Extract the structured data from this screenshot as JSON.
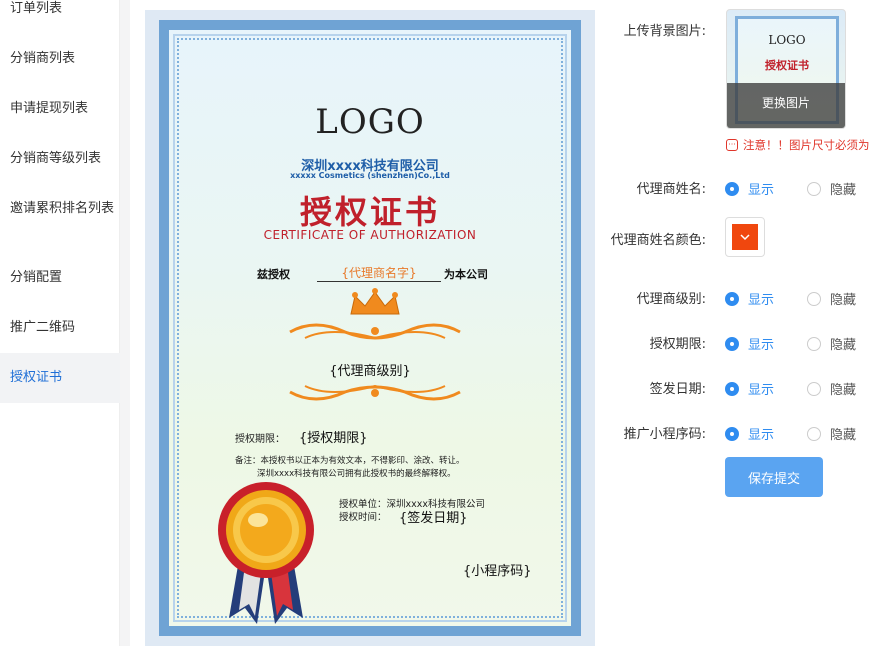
{
  "sidebar": {
    "items": [
      {
        "label": "订单列表"
      },
      {
        "label": "分销商列表"
      },
      {
        "label": "申请提现列表"
      },
      {
        "label": "分销商等级列表"
      },
      {
        "label": "邀请累积排名列表"
      },
      {
        "label": "分销配置"
      },
      {
        "label": "推广二维码"
      },
      {
        "label": "授权证书"
      }
    ],
    "active_index": 7
  },
  "certificate": {
    "logo": "LOGO",
    "company_cn": "深圳xxxx科技有限公司",
    "company_en": "xxxxx Cosmetics (shenzhen)Co.,Ltd",
    "title_cn": "授权证书",
    "title_en": "CERTIFICATE OF AUTHORIZATION",
    "grant_prefix": "兹授权",
    "agent_name_placeholder": "{代理商名字}",
    "grant_suffix": "为本公司",
    "agent_level_placeholder": "{代理商级别}",
    "period_label": "授权期限：",
    "period_placeholder": "{授权期限}",
    "note_line1": "备注：本授权书以正本为有效文本，不得影印、涂改、转让。",
    "note_line2": "深圳xxxx科技有限公司拥有此授权书的最终解释权。",
    "unit_line": "授权单位：深圳xxxx科技有限公司",
    "time_label": "授权时间：",
    "date_placeholder": "{签发日期}",
    "qrcode_placeholder": "{小程序码}"
  },
  "form": {
    "upload_label": "上传背景图片:",
    "thumb_logo": "LOGO",
    "thumb_title": "授权证书",
    "change_image_label": "更换图片",
    "notice": "注意！！图片尺寸必须为",
    "agent_name_label": "代理商姓名:",
    "agent_color_label": "代理商姓名颜色:",
    "agent_color": "#f0470e",
    "agent_level_label": "代理商级别:",
    "period_label": "授权期限:",
    "issue_date_label": "签发日期:",
    "qrcode_label": "推广小程序码:",
    "show_label": "显示",
    "hide_label": "隐藏",
    "save_label": "保存提交"
  },
  "colors": {
    "accent": "#2f8cf0",
    "title_red": "#c0202b",
    "placeholder_orange": "#e87a2b",
    "warning": "#e0362b"
  }
}
